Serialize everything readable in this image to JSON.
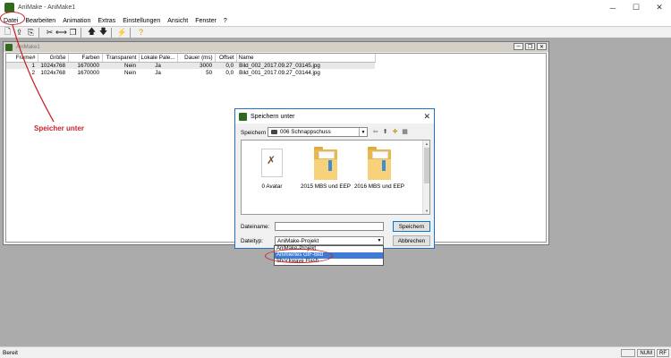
{
  "window": {
    "title": "AniMake - AniMake1",
    "controls": [
      "─",
      "☐",
      "✕"
    ]
  },
  "menu": [
    "Datei",
    "Bearbeiten",
    "Animation",
    "Extras",
    "Einstellungen",
    "Ansicht",
    "Fenster",
    "?"
  ],
  "toolbar": [
    "new-doc-icon",
    "open-icon",
    "save-icon",
    "cut-icon",
    "split-icon",
    "copy-icon",
    "up-arrow-icon",
    "down-arrow-icon",
    "lightning-icon",
    "help-icon"
  ],
  "child_window": {
    "title": "AniMake1",
    "columns": [
      "Frame#",
      "Größe",
      "Farben",
      "Transparent",
      "Lokale Pale...",
      "Dauer (ms)",
      "Offset",
      "Name"
    ],
    "rows": [
      [
        "1",
        "1024x768",
        "1670000",
        "Nein",
        "Ja",
        "3000",
        "0,0",
        "Bild_002_2017.09.27_03145.jpg"
      ],
      [
        "2",
        "1024x768",
        "1670000",
        "Nein",
        "Ja",
        "50",
        "0,0",
        "Bild_001_2017.09.27_03144.jpg"
      ]
    ]
  },
  "annotation": {
    "text": "Speicher unter",
    "color": "#c8242b"
  },
  "dialog": {
    "title": "Speichern unter",
    "save_in_label": "Speichern",
    "folder": "006 Schnappschuss",
    "items": [
      "0 Avatar",
      "2015 MBS und EEP",
      "2016 MBS und EEP"
    ],
    "filename_label": "Dateiname:",
    "filename_value": "",
    "filetype_label": "Dateityp:",
    "filetype_value": "AniMake-Projekt",
    "save_button": "Speichern",
    "cancel_button": "Abbrechen",
    "filetype_options": [
      "AniMake-Projekt",
      "Animiertes GIF-Bild",
      "Shockwave Flash"
    ],
    "highlighted_option": "Animiertes GIF-Bild"
  },
  "status": {
    "text": "Bereit",
    "panels": [
      "NUM",
      "RF"
    ]
  },
  "colors": {
    "mdi_background": "#ababab",
    "highlight": "#3d7bd6",
    "annotation_red": "#c8242b"
  }
}
